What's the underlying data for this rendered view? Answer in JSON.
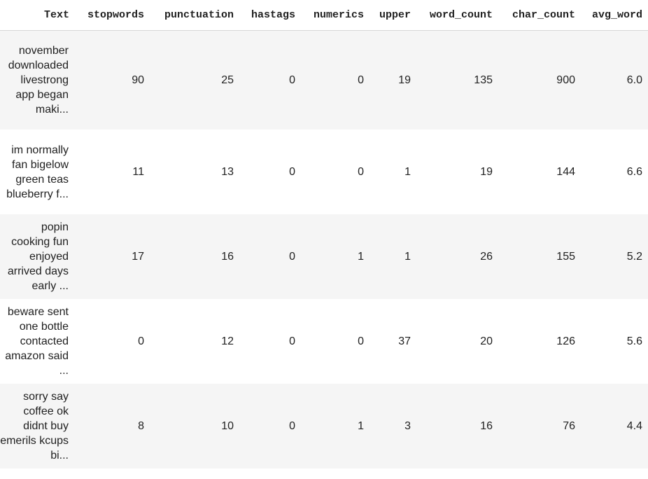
{
  "table": {
    "headers": [
      "Text",
      "stopwords",
      "punctuation",
      "hastags",
      "numerics",
      "upper",
      "word_count",
      "char_count",
      "avg_word"
    ],
    "rows": [
      [
        "november downloaded livestrong app began maki...",
        "90",
        "25",
        "0",
        "0",
        "19",
        "135",
        "900",
        "6.0"
      ],
      [
        "im normally fan bigelow green teas blueberry f...",
        "11",
        "13",
        "0",
        "0",
        "1",
        "19",
        "144",
        "6.6"
      ],
      [
        "popin cooking fun enjoyed arrived days early ...",
        "17",
        "16",
        "0",
        "1",
        "1",
        "26",
        "155",
        "5.2"
      ],
      [
        "beware sent one bottle contacted amazon said ...",
        "0",
        "12",
        "0",
        "0",
        "37",
        "20",
        "126",
        "5.6"
      ],
      [
        "sorry say coffee ok didnt buy emerils kcups bi...",
        "8",
        "10",
        "0",
        "1",
        "3",
        "16",
        "76",
        "4.4"
      ]
    ]
  }
}
